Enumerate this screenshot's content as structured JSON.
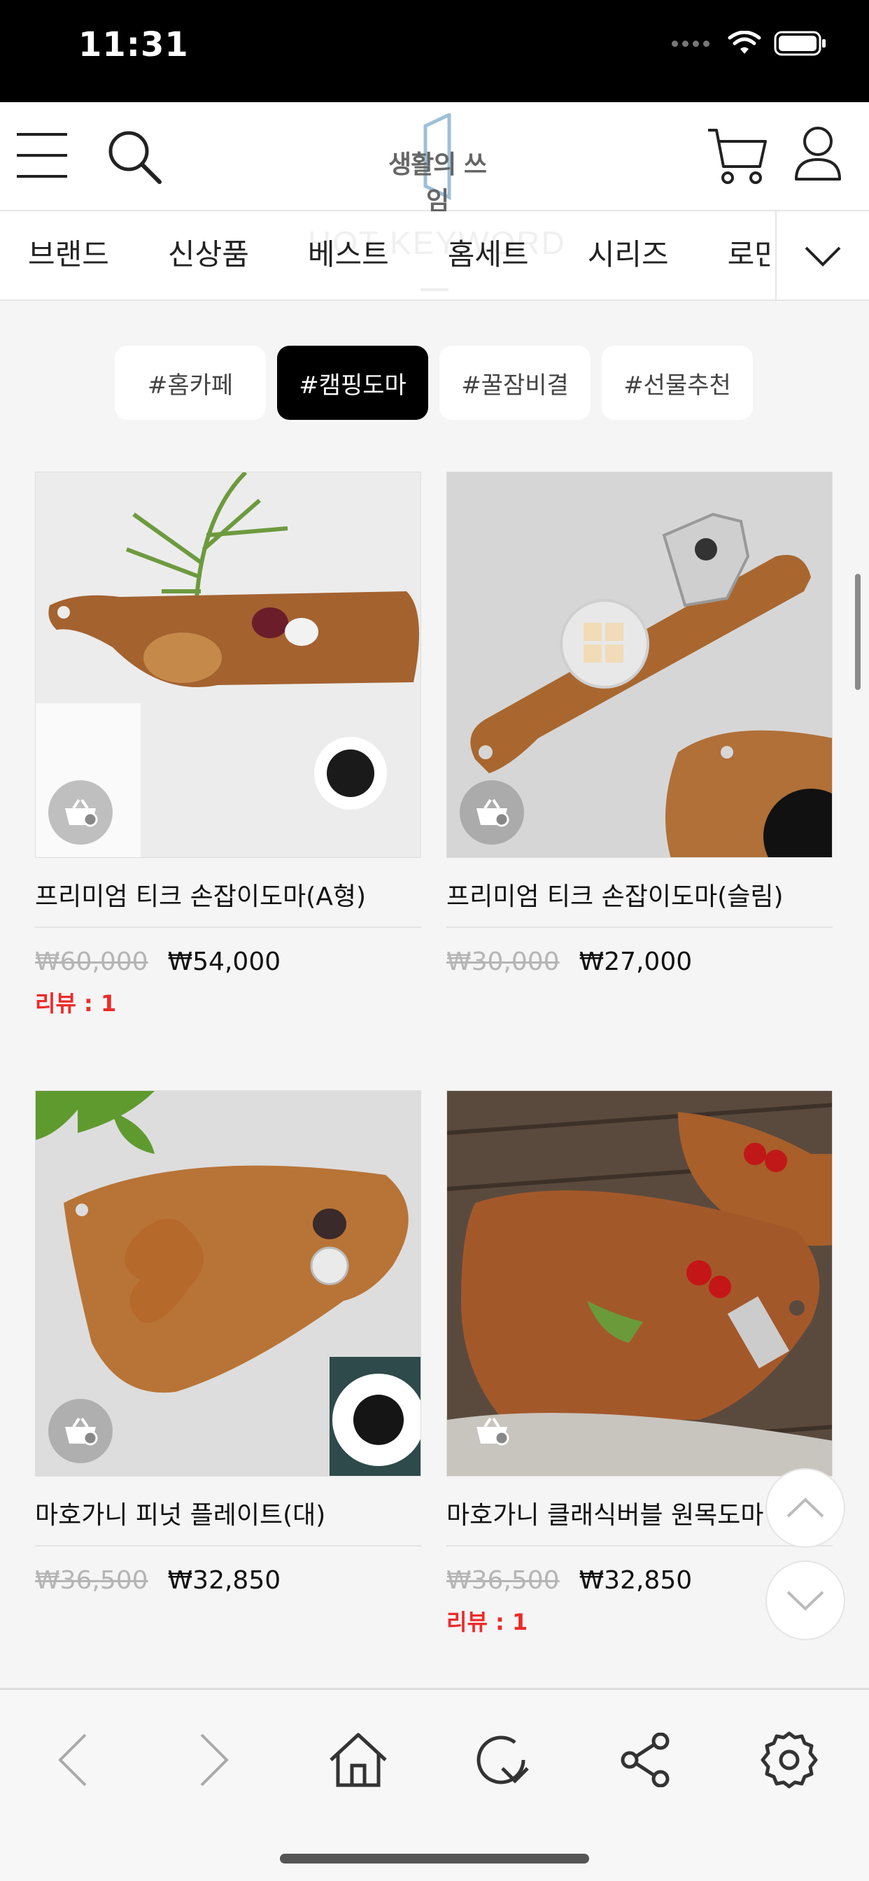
{
  "status_bar": {
    "time": "11:31"
  },
  "header": {
    "logo_text": "생활의 쓰임",
    "icons": [
      "menu-icon",
      "search-icon",
      "cart-icon",
      "user-icon"
    ]
  },
  "category_nav": {
    "background_text": "HOT KEYWORD",
    "items": [
      "브랜드",
      "신상품",
      "베스트",
      "홈세트",
      "시리즈",
      "로만"
    ]
  },
  "keywords": {
    "chips": [
      "#홈카페",
      "#캠핑도마",
      "#꿀잠비결",
      "#선물추천"
    ],
    "active_index": 1
  },
  "products": [
    {
      "name": "프리미엄 티크 손잡이도마(A형)",
      "original_price": "₩60,000",
      "sale_price": "₩54,000",
      "review": "리뷰 : 1"
    },
    {
      "name": "프리미엄 티크 손잡이도마(슬림)",
      "original_price": "₩30,000",
      "sale_price": "₩27,000",
      "review": ""
    },
    {
      "name": "마호가니 피넛 플레이트(대)",
      "original_price": "₩36,500",
      "sale_price": "₩32,850",
      "review": ""
    },
    {
      "name": "마호가니 클래식버블 원목도마",
      "original_price": "₩36,500",
      "sale_price": "₩32,850",
      "review": "리뷰 : 1"
    }
  ],
  "colors": {
    "accent_red": "#ee2a2a",
    "active_chip": "#000000",
    "wood": "#a4622f"
  }
}
